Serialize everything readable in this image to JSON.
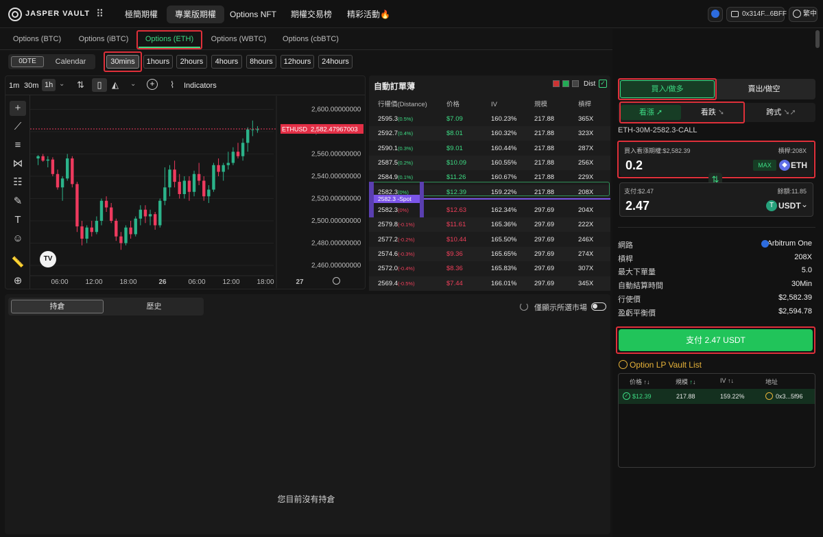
{
  "header": {
    "logo_text": "JASPER VAULT",
    "nav": [
      "極簡期權",
      "專業版期權",
      "Options NFT",
      "期權交易榜",
      "精彩活動🔥"
    ],
    "wallet": "0x314F...6BFF",
    "lang": "繁中"
  },
  "option_tabs": [
    "Options (BTC)",
    "Options (iBTC)",
    "Options (ETH)",
    "Options (WBTC)",
    "Options (cbBTC)"
  ],
  "expiry": {
    "zero_dte": "0DTE",
    "calendar": "Calendar"
  },
  "durations": [
    "30mins",
    "1hours",
    "2hours",
    "4hours",
    "8hours",
    "12hours",
    "24hours"
  ],
  "chart_toolbar": {
    "intervals": [
      "1m",
      "30m",
      "1h"
    ],
    "indicators": "Indicators"
  },
  "chart_data": {
    "type": "candlestick",
    "symbol": "ETHUSD",
    "last_price": "2,582.47967003",
    "yticks": [
      "2,600.00000000",
      "2,580.00000000",
      "2,560.00000000",
      "2,540.00000000",
      "2,520.00000000",
      "2,500.00000000",
      "2,480.00000000",
      "2,460.00000000"
    ],
    "xticks": [
      "06:00",
      "12:00",
      "18:00",
      "26",
      "06:00",
      "12:00",
      "18:00",
      "27"
    ],
    "ylim": [
      2452,
      2612
    ],
    "candles": [
      [
        2556,
        2559,
        2550,
        2558
      ],
      [
        2558,
        2560,
        2553,
        2554
      ],
      [
        2554,
        2558,
        2548,
        2555
      ],
      [
        2555,
        2557,
        2540,
        2542
      ],
      [
        2542,
        2546,
        2528,
        2530
      ],
      [
        2530,
        2540,
        2518,
        2538
      ],
      [
        2538,
        2560,
        2536,
        2556
      ],
      [
        2556,
        2558,
        2530,
        2533
      ],
      [
        2533,
        2535,
        2490,
        2495
      ],
      [
        2495,
        2500,
        2478,
        2484
      ],
      [
        2484,
        2496,
        2480,
        2494
      ],
      [
        2494,
        2500,
        2486,
        2490
      ],
      [
        2490,
        2504,
        2488,
        2500
      ],
      [
        2500,
        2520,
        2496,
        2518
      ],
      [
        2518,
        2522,
        2508,
        2512
      ],
      [
        2512,
        2516,
        2498,
        2500
      ],
      [
        2500,
        2502,
        2482,
        2486
      ],
      [
        2486,
        2490,
        2474,
        2480
      ],
      [
        2480,
        2496,
        2478,
        2494
      ],
      [
        2494,
        2500,
        2484,
        2488
      ],
      [
        2488,
        2504,
        2486,
        2502
      ],
      [
        2502,
        2514,
        2496,
        2510
      ],
      [
        2510,
        2514,
        2498,
        2504
      ],
      [
        2504,
        2510,
        2496,
        2506
      ],
      [
        2506,
        2508,
        2492,
        2496
      ],
      [
        2496,
        2520,
        2494,
        2518
      ],
      [
        2518,
        2548,
        2514,
        2530
      ],
      [
        2530,
        2550,
        2522,
        2546
      ],
      [
        2546,
        2554,
        2530,
        2535
      ],
      [
        2535,
        2542,
        2520,
        2524
      ],
      [
        2524,
        2540,
        2520,
        2536
      ],
      [
        2536,
        2540,
        2518,
        2526
      ],
      [
        2526,
        2545,
        2522,
        2542
      ],
      [
        2542,
        2552,
        2532,
        2536
      ],
      [
        2536,
        2540,
        2518,
        2522
      ],
      [
        2522,
        2532,
        2516,
        2528
      ],
      [
        2528,
        2552,
        2526,
        2550
      ],
      [
        2550,
        2556,
        2540,
        2544
      ],
      [
        2544,
        2552,
        2536,
        2550
      ],
      [
        2550,
        2562,
        2546,
        2552
      ],
      [
        2552,
        2566,
        2550,
        2562
      ],
      [
        2562,
        2570,
        2556,
        2558
      ],
      [
        2558,
        2574,
        2554,
        2570
      ],
      [
        2570,
        2584,
        2562,
        2582
      ],
      [
        2582,
        2590,
        2576,
        2582
      ],
      [
        2582,
        2585,
        2579,
        2582
      ]
    ]
  },
  "orderbook": {
    "title": "自動訂單薄",
    "dist": "Dist",
    "headers": [
      "行權價(Distance)",
      "价格",
      "IV",
      "規模",
      "槓桿"
    ],
    "calls": [
      [
        "2595.3",
        "(0.5%)",
        "$7.09",
        "160.23%",
        "217.88",
        "365X"
      ],
      [
        "2592.7",
        "(0.4%)",
        "$8.01",
        "160.32%",
        "217.88",
        "323X"
      ],
      [
        "2590.1",
        "(0.3%)",
        "$9.01",
        "160.44%",
        "217.88",
        "287X"
      ],
      [
        "2587.5",
        "(0.2%)",
        "$10.09",
        "160.55%",
        "217.88",
        "256X"
      ],
      [
        "2584.9",
        "(0.1%)",
        "$11.26",
        "160.67%",
        "217.88",
        "229X"
      ],
      [
        "2582.3",
        "(0%)",
        "$12.39",
        "159.22%",
        "217.88",
        "208X"
      ]
    ],
    "spot": "2582.3 -Spot",
    "puts": [
      [
        "2582.3",
        "(0%)",
        "$12.63",
        "162.34%",
        "297.69",
        "204X"
      ],
      [
        "2579.8",
        "(-0.1%)",
        "$11.61",
        "165.36%",
        "297.69",
        "222X"
      ],
      [
        "2577.2",
        "(-0.2%)",
        "$10.44",
        "165.50%",
        "297.69",
        "246X"
      ],
      [
        "2574.6",
        "(-0.3%)",
        "$9.36",
        "165.65%",
        "297.69",
        "274X"
      ],
      [
        "2572.0",
        "(-0.4%)",
        "$8.36",
        "165.83%",
        "297.69",
        "307X"
      ],
      [
        "2569.4",
        "(-0.5%)",
        "$7.44",
        "166.01%",
        "297.69",
        "345X"
      ]
    ]
  },
  "positions": {
    "tab_active": "持倉",
    "tab_history": "歷史",
    "toggle_label": "僅顯示所選市場",
    "empty": "您目前沒有持倉"
  },
  "trade": {
    "buy_tab": "買入/做多",
    "sell_tab": "賣出/做空",
    "call": "看漲",
    "put": "看跌",
    "straddle": "跨式",
    "symbol": "ETH-30M-2582.3-CALL",
    "input_label": "買入看漲期權:$2,582.39",
    "leverage_label": "槓桿:208X",
    "amount": "0.2",
    "max": "MAX",
    "asset": "ETH",
    "pay_label": "支付:$2.47",
    "balance_label": "餘額:11.85",
    "pay_amount": "2.47",
    "pay_asset": "USDT",
    "details": [
      {
        "k": "網路",
        "v": "Arbitrum One"
      },
      {
        "k": "槓桿",
        "v": "208X"
      },
      {
        "k": "最大下單量",
        "v": "5.0"
      },
      {
        "k": "自動結算時間",
        "v": "30Min"
      },
      {
        "k": "行使價",
        "v": "$2,582.39"
      },
      {
        "k": "盈虧平衡價",
        "v": "$2,594.78"
      }
    ],
    "pay_button": "支付 2.47 USDT"
  },
  "lp": {
    "title": "Option LP Vault List",
    "headers": [
      "价格",
      "規模",
      "IV",
      "地址"
    ],
    "row": {
      "price": "$12.39",
      "size": "217.88",
      "iv": "159.22%",
      "addr": "0x3...5f96"
    }
  },
  "colors": {
    "green": "#3ddc84",
    "red": "#ef3f5a",
    "accent_border": "#e0303a",
    "pay_button": "#21c45a"
  }
}
